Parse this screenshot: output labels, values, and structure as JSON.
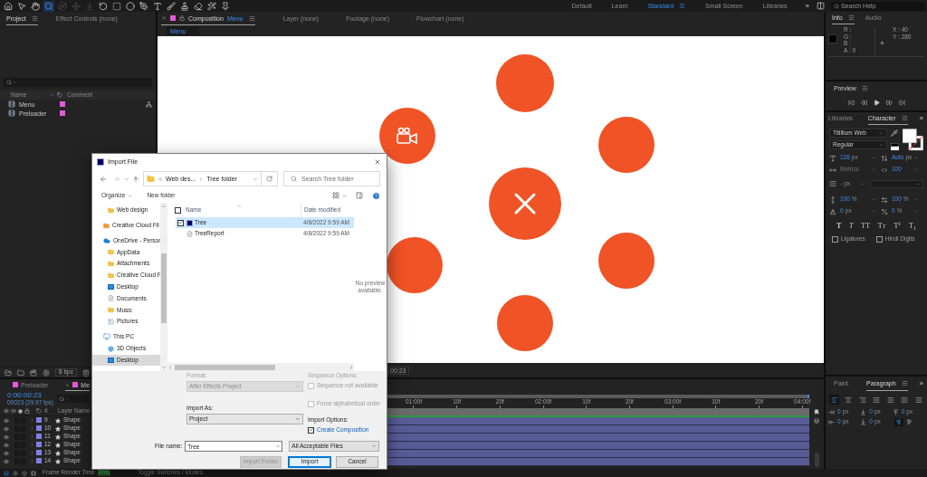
{
  "toolbar": {
    "tools": [
      {
        "selected": false,
        "disabled": false
      },
      {
        "selected": false,
        "disabled": false
      },
      {
        "selected": false,
        "disabled": false
      },
      {
        "selected": true,
        "disabled": false
      },
      {
        "selected": false,
        "disabled": true
      },
      {
        "selected": false,
        "disabled": true
      },
      {
        "selected": false,
        "disabled": true
      },
      {
        "selected": false,
        "disabled": false
      },
      {
        "selected": false,
        "disabled": false
      },
      {
        "selected": false,
        "disabled": false
      },
      {
        "selected": false,
        "disabled": false
      },
      {
        "selected": false,
        "disabled": false
      },
      {
        "selected": false,
        "disabled": false
      },
      {
        "selected": false,
        "disabled": false
      },
      {
        "selected": false,
        "disabled": false
      },
      {
        "selected": false,
        "disabled": false
      },
      {
        "selected": false,
        "disabled": false
      }
    ],
    "workspaces": [
      {
        "label": "Default",
        "selected": false
      },
      {
        "label": "Learn",
        "selected": false
      },
      {
        "label": "Standard",
        "selected": true
      },
      {
        "label": "Small Screen",
        "selected": false
      },
      {
        "label": "Libraries",
        "selected": false
      }
    ],
    "overflow": "»",
    "search": {
      "placeholder": "Search Help"
    }
  },
  "project_panel": {
    "tabs": [
      {
        "label": "Project",
        "selected": true
      },
      {
        "label": "Effect Controls (none)",
        "selected": false
      }
    ],
    "columns": [
      "Name",
      "Comment"
    ],
    "items": [
      {
        "name": "Menu",
        "color": "#e25ad9"
      },
      {
        "name": "Preloader",
        "color": "#e25ad9"
      }
    ],
    "bit_depth": "8 bpc"
  },
  "composition_panel": {
    "tabs": [
      {
        "label": "Composition",
        "comp": "Menu",
        "color": "#e25ad9",
        "selected": true
      },
      {
        "label": "Layer (none)",
        "selected": false
      },
      {
        "label": "Footage (none)",
        "selected": false
      },
      {
        "label": "Flowchart (none)",
        "selected": false
      }
    ],
    "breadcrumb": "Menu",
    "time": "00:23"
  },
  "info_panel": {
    "tabs": [
      {
        "label": "Info",
        "selected": true
      },
      {
        "label": "Audio",
        "selected": false
      }
    ],
    "color_values": [
      "R :",
      "G :",
      "B :",
      "A : 0"
    ],
    "position": [
      "X : 40",
      "Y : 280"
    ]
  },
  "preview_panel": {
    "title": "Preview"
  },
  "character_panel": {
    "tabs": [
      {
        "label": "Libraries",
        "selected": false
      },
      {
        "label": "Character",
        "selected": true
      }
    ],
    "overflow": "»",
    "font": "Titillium Web",
    "style": "Regular",
    "metrics": [
      {
        "value": "126",
        "unit": "px",
        "disabled": false
      },
      {
        "value": "Auto",
        "unit": "px",
        "disabled": false
      },
      {
        "value": "Metrics",
        "disabled": true
      },
      {
        "value": "100",
        "disabled": false
      }
    ],
    "stroke": {
      "value": "-",
      "unit": "px"
    },
    "scale": [
      {
        "value": "100",
        "unit": "%"
      },
      {
        "value": "100",
        "unit": "%"
      },
      {
        "value": "0",
        "unit": "px"
      },
      {
        "value": "0",
        "unit": "%"
      }
    ],
    "styles": [
      {
        "label": "T",
        "kind": "bold"
      },
      {
        "label": "T",
        "kind": "italic"
      },
      {
        "label": "TT",
        "kind": "caps"
      },
      {
        "label": "TT",
        "kind": "smallcaps"
      },
      {
        "label": "T$^{1}$",
        "kind": "super"
      },
      {
        "label": "T$_{1}$",
        "kind": "sub"
      }
    ],
    "options": [
      {
        "label": "Ligatures",
        "checked": false
      },
      {
        "label": "Hindi Digits",
        "checked": false
      }
    ]
  },
  "paragraph_panel": {
    "tabs": [
      {
        "label": "Paint",
        "selected": false
      },
      {
        "label": "Paragraph",
        "selected": true
      }
    ],
    "overflow": "»",
    "align": [
      {
        "selected": true
      },
      {
        "selected": false
      },
      {
        "selected": false
      },
      {
        "selected": false
      },
      {
        "selected": false
      },
      {
        "selected": false
      },
      {
        "selected": false
      }
    ],
    "indents": [
      {
        "value": "0",
        "unit": "px"
      },
      {
        "value": "0",
        "unit": "px"
      },
      {
        "value": "0",
        "unit": "px"
      },
      {
        "value": "0",
        "unit": "px"
      },
      {
        "value": "0",
        "unit": "px"
      }
    ],
    "direction": [
      {
        "selected": true
      },
      {
        "selected": false
      }
    ]
  },
  "timeline": {
    "tabs": [
      {
        "label": "Preloader",
        "color": "#e25ad9",
        "selected": false
      },
      {
        "label": "Me",
        "color": "#e25ad9",
        "selected": true
      }
    ],
    "timecode": "0:00:00:23",
    "frame_info": "00023 (29.97 fps)",
    "columns": [
      "#",
      "Layer Name"
    ],
    "layers": [
      {
        "number": "9",
        "name": "Shape",
        "color": "#7c80e6",
        "visible": true
      },
      {
        "number": "10",
        "name": "Shape",
        "color": "#7c80e6",
        "visible": true
      },
      {
        "number": "11",
        "name": "Shape",
        "color": "#7c80e6",
        "visible": true
      },
      {
        "number": "12",
        "name": "Shape",
        "color": "#7c80e6",
        "visible": true
      },
      {
        "number": "13",
        "name": "Shape",
        "color": "#7c80e6",
        "visible": true
      },
      {
        "number": "14",
        "name": "Shape",
        "color": "#7c80e6",
        "visible": true
      }
    ],
    "ruler": [
      "01:00f",
      "10f",
      "20f",
      "02:00f",
      "10f",
      "20f",
      "03:00f",
      "10f",
      "20f",
      "04:00f"
    ]
  },
  "status_bar": {
    "label": "Frame Render Time",
    "value": "0ms",
    "toggle": "Toggle Switches / Modes"
  },
  "import_dialog": {
    "title": "Import File",
    "path": [
      "Web des...",
      "Tree folder"
    ],
    "search": {
      "placeholder": "Search Tree folder"
    },
    "commands": [
      "Organize",
      "New folder"
    ],
    "nav_tree": {
      "continued_children": [
        {
          "label": "Web design",
          "kind": "folder",
          "selected": false
        }
      ],
      "items": [
        {
          "label": "Creative Cloud Fil",
          "kind": "cloud-folder",
          "selected": false
        },
        {
          "label": "OneDrive - Persor",
          "kind": "onedrive",
          "selected": false,
          "children": [
            {
              "label": "AppData",
              "kind": "folder",
              "selected": false
            },
            {
              "label": "Attachments",
              "kind": "folder",
              "selected": false
            },
            {
              "label": "Creative Cloud F",
              "kind": "folder",
              "selected": false
            },
            {
              "label": "Desktop",
              "kind": "desktop",
              "selected": false
            },
            {
              "label": "Documents",
              "kind": "documents",
              "selected": false
            },
            {
              "label": "Music",
              "kind": "folder",
              "selected": false
            },
            {
              "label": "Pictures",
              "kind": "pictures",
              "selected": false
            }
          ]
        },
        {
          "label": "This PC",
          "kind": "pc",
          "selected": false,
          "children": [
            {
              "label": "3D Objects",
              "kind": "objects",
              "selected": false
            },
            {
              "label": "Desktop",
              "kind": "desktop",
              "selected": true
            }
          ]
        }
      ]
    },
    "header_checked": false,
    "columns": [
      "Name",
      "Date modified"
    ],
    "files": [
      {
        "name": "Tree",
        "kind": "project",
        "date": "4/8/2022 9:59 AM",
        "selected": true,
        "checked": true
      },
      {
        "name": "TreeReport",
        "kind": "text",
        "date": "4/8/2022 9:59 AM",
        "selected": false,
        "checked": false
      }
    ],
    "preview": "No preview available.",
    "format": {
      "label": "Format:",
      "value": "After Effects Project",
      "disabled": true
    },
    "sequence": {
      "label": "Sequence Options:",
      "disabled": true,
      "options": [
        {
          "label": "Sequence not available",
          "checked": false,
          "disabled": true
        },
        {
          "label": "Force alphabetical order",
          "checked": false,
          "disabled": true
        }
      ]
    },
    "import_as": {
      "label": "Import As:",
      "value": "Project",
      "disabled": false
    },
    "import_options": {
      "label": "Import Options:",
      "options": [
        {
          "label": "Create Composition",
          "checked": true,
          "disabled": false
        }
      ]
    },
    "file_name": {
      "label": "File name:",
      "value": "Tree"
    },
    "file_type": "All Acceptable Files",
    "buttons": [
      {
        "label": "Import Folder",
        "disabled": true,
        "default": false
      },
      {
        "label": "Import",
        "disabled": false,
        "default": true
      },
      {
        "label": "Cancel",
        "disabled": false,
        "default": false
      }
    ]
  }
}
